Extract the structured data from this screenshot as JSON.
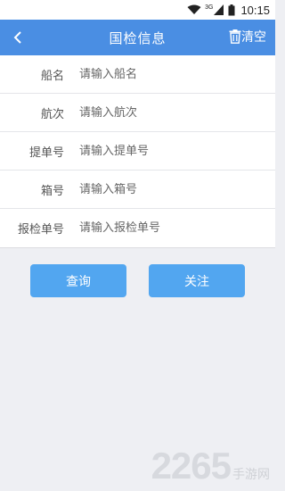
{
  "status_bar": {
    "network": "3G",
    "time": "10:15"
  },
  "app_bar": {
    "title": "国检信息",
    "clear_label": "清空",
    "back_icon": "chevron-left-icon",
    "clear_icon": "trash-icon"
  },
  "form": {
    "fields": [
      {
        "label": "船名",
        "placeholder": "请输入船名",
        "value": ""
      },
      {
        "label": "航次",
        "placeholder": "请输入航次",
        "value": ""
      },
      {
        "label": "提单号",
        "placeholder": "请输入提单号",
        "value": ""
      },
      {
        "label": "箱号",
        "placeholder": "请输入箱号",
        "value": ""
      },
      {
        "label": "报检单号",
        "placeholder": "请输入报检单号",
        "value": ""
      }
    ]
  },
  "buttons": {
    "query": "查询",
    "follow": "关注"
  },
  "watermark": {
    "number": "2265",
    "suffix": "手游网"
  },
  "colors": {
    "primary": "#4a8ee3",
    "button": "#52a6f0",
    "background": "#eeeff3"
  }
}
